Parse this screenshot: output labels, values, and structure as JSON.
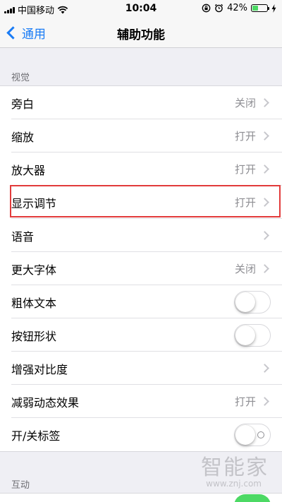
{
  "status_bar": {
    "carrier": "中国移动",
    "time": "10:04",
    "battery": "42%",
    "battery_level": 0.42
  },
  "nav": {
    "back_label": "通用",
    "title": "辅助功能"
  },
  "sections": {
    "vision_header": "视觉",
    "interaction_header": "互动"
  },
  "rows": [
    {
      "label": "旁白",
      "value": "关闭"
    },
    {
      "label": "缩放",
      "value": "打开"
    },
    {
      "label": "放大器",
      "value": "打开"
    },
    {
      "label": "显示调节",
      "value": "打开"
    },
    {
      "label": "语音",
      "value": ""
    },
    {
      "label": "更大字体",
      "value": "关闭"
    },
    {
      "label": "粗体文本",
      "toggle": false
    },
    {
      "label": "按钮形状",
      "toggle": false
    },
    {
      "label": "增强对比度",
      "value": ""
    },
    {
      "label": "减弱动态效果",
      "value": "打开"
    },
    {
      "label": "开/关标签",
      "toggle": false
    }
  ],
  "watermark": {
    "title": "智能家",
    "url": "www.znj.com"
  }
}
